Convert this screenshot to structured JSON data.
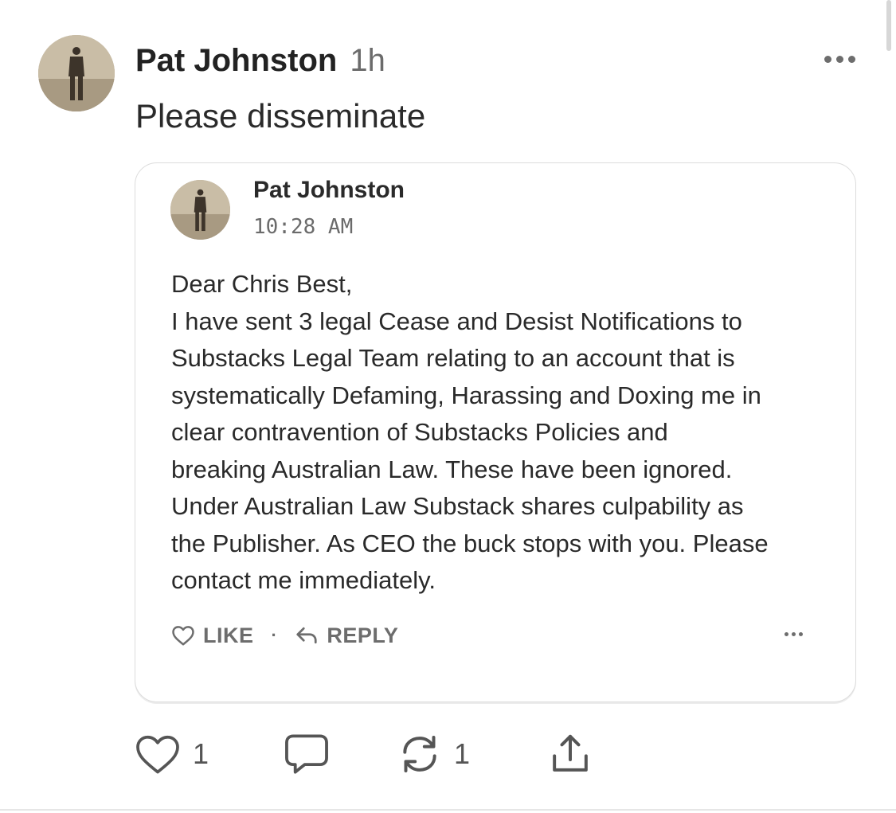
{
  "post": {
    "author_name": "Pat Johnston",
    "time_ago": "1h",
    "body": "Please disseminate"
  },
  "quoted_comment": {
    "author_name": "Pat Johnston",
    "time": "10:28 AM",
    "lines": [
      "Dear Chris Best,",
      "I have sent 3 legal Cease and Desist Notifications to",
      "Substacks Legal Team relating to an account that is",
      "systematically Defaming, Harassing and Doxing me in",
      "clear contravention of Substacks Policies and",
      "breaking Australian Law. These have been ignored.",
      "Under Australian Law Substack shares culpability as",
      "the Publisher. As CEO the buck stops with you. Please",
      "contact me immediately."
    ],
    "like_label": "LIKE",
    "separator": "·",
    "reply_label": "REPLY"
  },
  "actions": {
    "like_count": "1",
    "restack_count": "1"
  },
  "icons": {
    "post_more": "more-horizontal-icon",
    "quote_like": "heart-outline-icon",
    "quote_reply": "reply-arrow-icon",
    "quote_more": "more-horizontal-icon",
    "like": "heart-outline-icon",
    "comment": "comment-bubble-icon",
    "restack": "restack-icon",
    "share": "share-upload-icon"
  }
}
